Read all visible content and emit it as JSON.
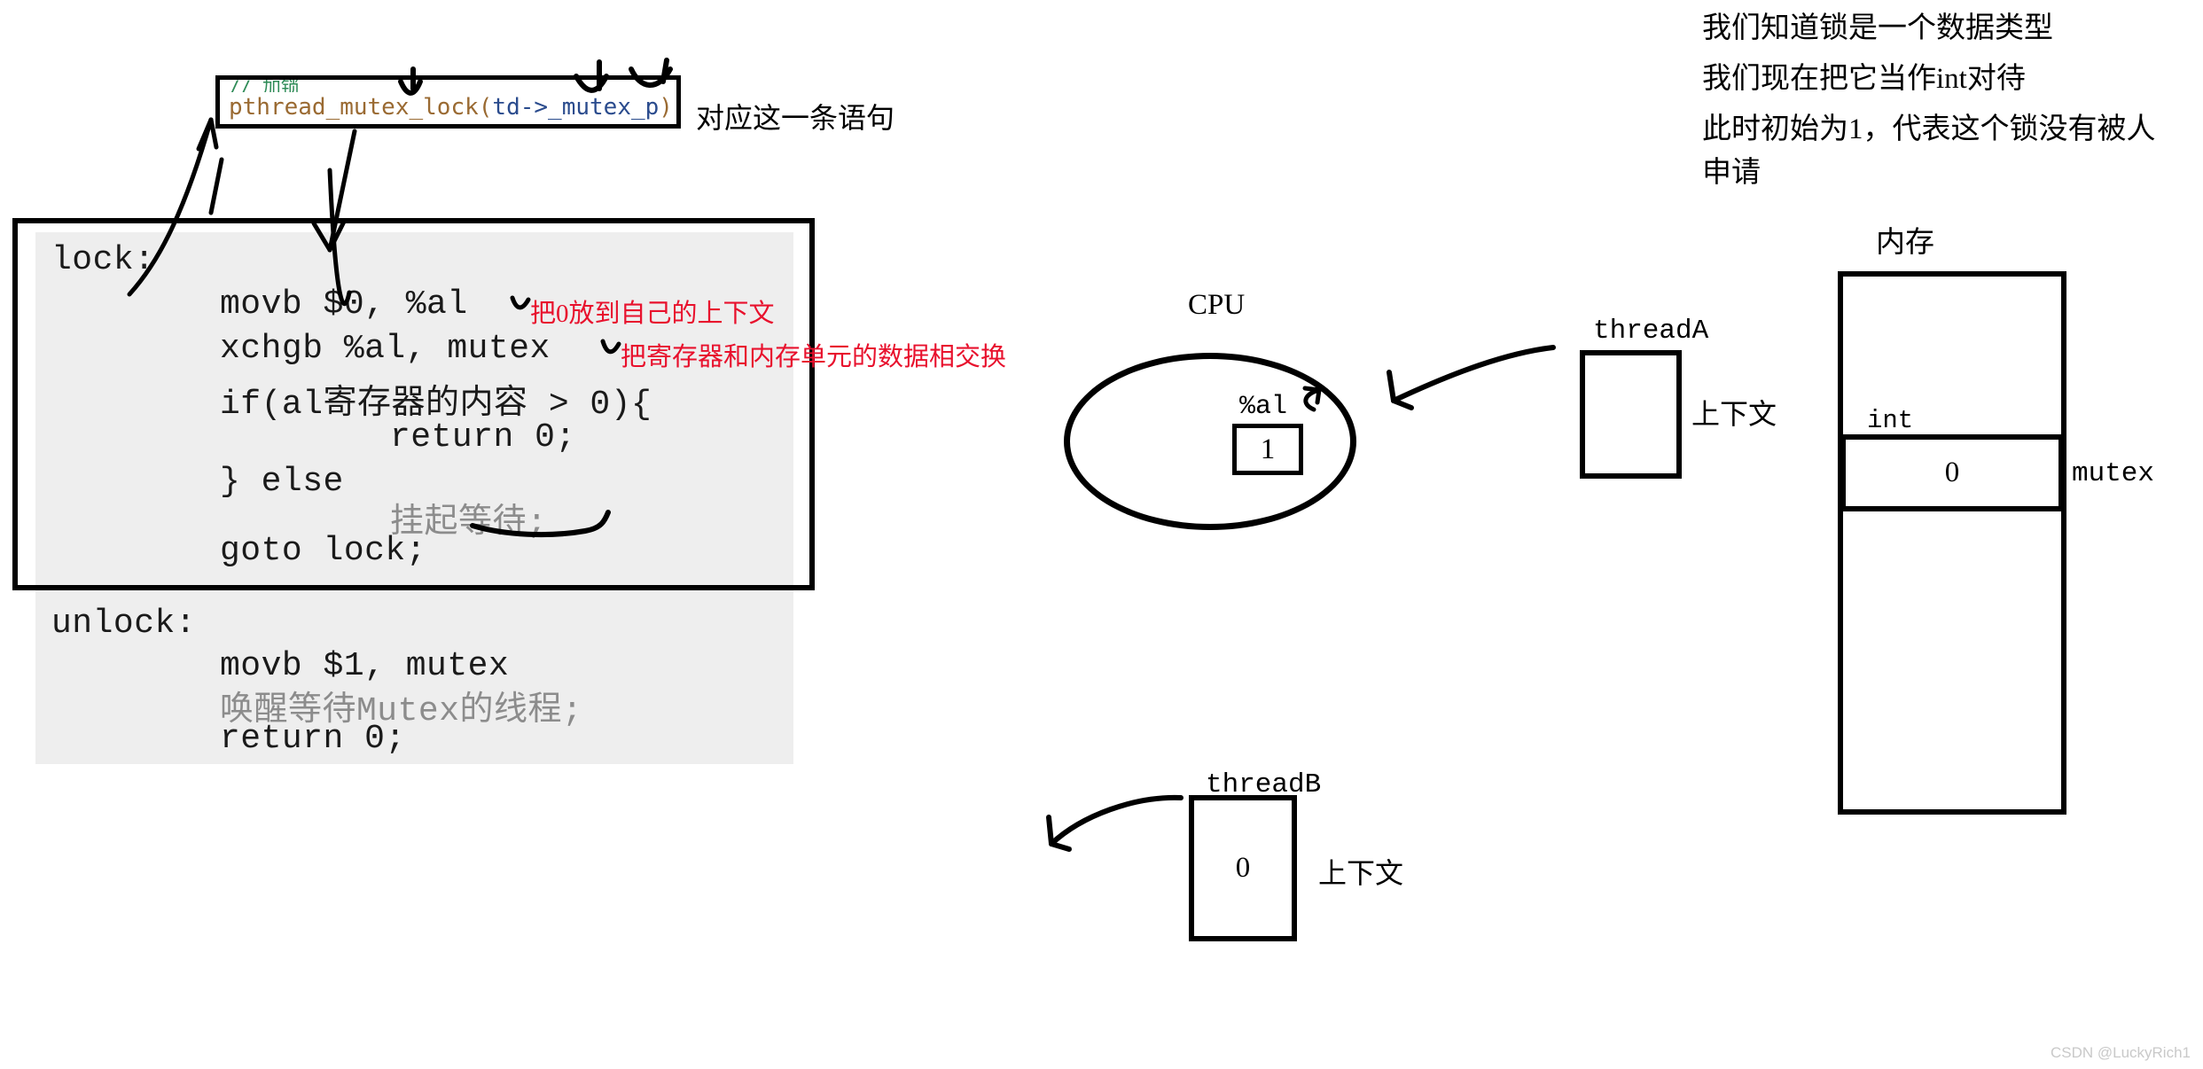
{
  "snippet": {
    "comment": "// 加锁",
    "code_prefix": "pthread_mutex_lock(",
    "code_var": "td->",
    "code_member": "_mutex_p",
    "code_suffix": ");",
    "full": "pthread_mutex_lock(td->_mutex_p);"
  },
  "snippet_note": "对应这一条语句",
  "pseudocode": {
    "lock_label": "lock:",
    "lines": [
      "movb $0, %al",
      "xchgb %al, mutex",
      "if(al寄存器的内容 > 0){",
      "return 0;",
      "} else",
      "挂起等待;",
      "goto lock;"
    ],
    "unlock_label": "unlock:",
    "unlock_lines": [
      "movb $1, mutex",
      "唤醒等待Mutex的线程;",
      "return 0;"
    ]
  },
  "red_notes": [
    "把0放到自己的上下文",
    "把寄存器和内存单元的数据相交换"
  ],
  "right_notes": [
    "我们知道锁是一个数据类型",
    "我们现在把它当作int对待",
    "此时初始为1，代表这个锁没有被人申请"
  ],
  "cpu": {
    "title": "CPU",
    "register_name": "%al",
    "register_value": "1"
  },
  "threadA": {
    "title": "threadA",
    "value": "",
    "context_label": "上下文"
  },
  "threadB": {
    "title": "threadB",
    "value": "0",
    "context_label": "上下文"
  },
  "memory": {
    "title": "内存",
    "type_label": "int",
    "cell_value": "0",
    "cell_name": "mutex"
  },
  "watermark": "CSDN @LuckyRich1",
  "colors": {
    "red_annotation": "#e8112d",
    "code_background": "#eeeeee",
    "gray_code_text": "#8c8c8c",
    "border": "#000000",
    "watermark": "#c9c9c9"
  }
}
